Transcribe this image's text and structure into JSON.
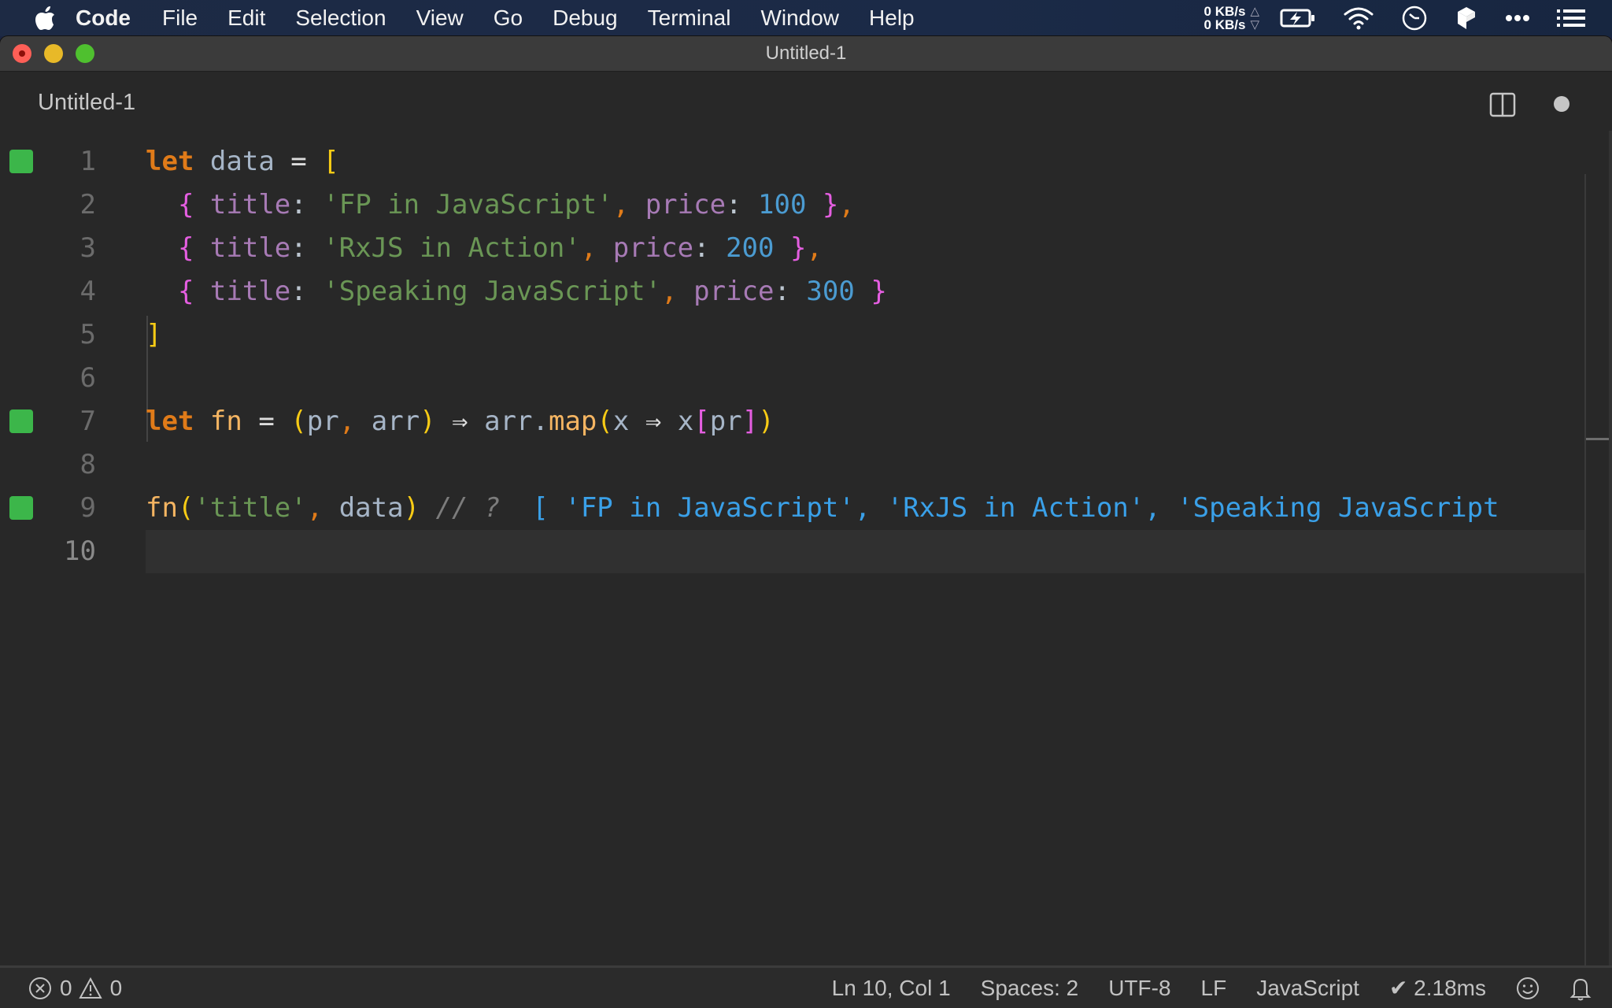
{
  "menubar": {
    "app_name": "Code",
    "items": [
      "File",
      "Edit",
      "Selection",
      "View",
      "Go",
      "Debug",
      "Terminal",
      "Window",
      "Help"
    ],
    "network": {
      "upload": "0 KB/s",
      "download": "0 KB/s",
      "up_arrow": "△",
      "down_arrow": "▽"
    },
    "tray_icons": [
      "battery-charging-icon",
      "wifi-icon",
      "time-machine-icon",
      "cube-app-icon",
      "more-icon",
      "notification-list-icon"
    ]
  },
  "window": {
    "title": "Untitled-1"
  },
  "tab": {
    "label": "Untitled-1",
    "split_icon": "split-editor-icon",
    "dirty_indicator": "unsaved-dot"
  },
  "editor": {
    "current_line": 10,
    "lines": [
      {
        "n": "1",
        "marker": true
      },
      {
        "n": "2",
        "marker": false
      },
      {
        "n": "3",
        "marker": false
      },
      {
        "n": "4",
        "marker": false
      },
      {
        "n": "5",
        "marker": false
      },
      {
        "n": "6",
        "marker": false
      },
      {
        "n": "7",
        "marker": true
      },
      {
        "n": "8",
        "marker": false
      },
      {
        "n": "9",
        "marker": true
      },
      {
        "n": "10",
        "marker": false
      }
    ],
    "tokens": {
      "let": "let",
      "data": "data",
      "eq": "=",
      "lbracket": "[",
      "rbracket": "]",
      "lbrace": "{",
      "rbrace": "}",
      "title_key": "title",
      "price_key": "price",
      "colon": ":",
      "comma": ",",
      "books": [
        {
          "title": "'FP in JavaScript'",
          "price": "100",
          "trailing": ","
        },
        {
          "title": "'RxJS in Action'",
          "price": "200",
          "trailing": ","
        },
        {
          "title": "'Speaking JavaScript'",
          "price": "300",
          "trailing": ""
        }
      ],
      "fn": "fn",
      "lparen": "(",
      "rparen": ")",
      "pr": "pr",
      "arr": "arr",
      "arrow": "⇒",
      "dot": ".",
      "map": "map",
      "x": "x",
      "title_str": "'title'",
      "comment": "// ?",
      "result": "[ 'FP in JavaScript', 'RxJS in Action', 'Speaking JavaScript"
    }
  },
  "statusbar": {
    "errors": "0",
    "warnings": "0",
    "position": "Ln 10, Col 1",
    "indent": "Spaces: 2",
    "encoding": "UTF-8",
    "eol": "LF",
    "language": "JavaScript",
    "timing": "✔ 2.18ms"
  }
}
